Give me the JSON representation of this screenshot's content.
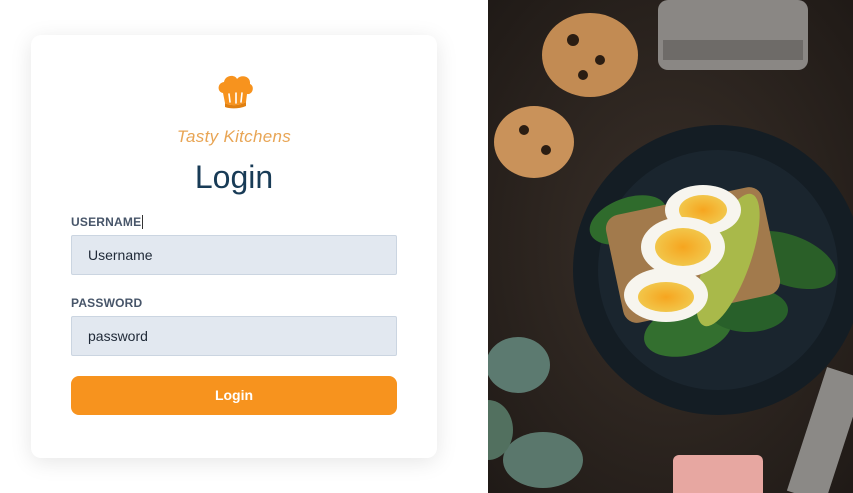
{
  "brand": {
    "name": "Tasty Kitchens",
    "logo_icon": "chef-hat-icon",
    "accent_color": "#f7931e"
  },
  "login_form": {
    "title": "Login",
    "username_label": "USERNAME",
    "username_value": "Username",
    "password_label": "PASSWORD",
    "password_value": "password",
    "submit_label": "Login"
  },
  "hero_image": {
    "subject": "food-photo"
  }
}
